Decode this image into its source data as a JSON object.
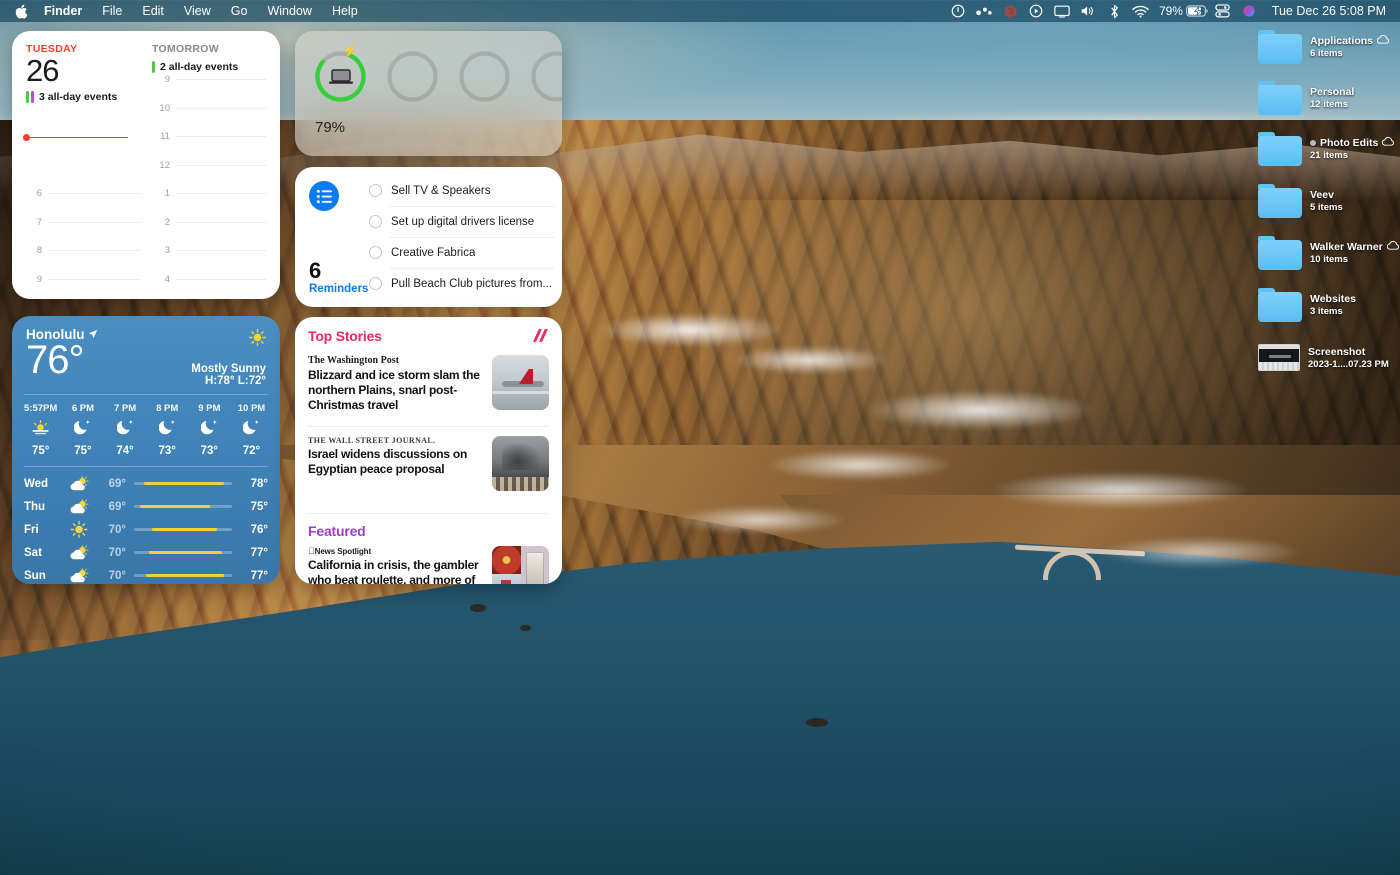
{
  "menubar": {
    "apple_icon": "apple-logo-icon",
    "items": [
      {
        "label": "Finder",
        "bold": true
      },
      {
        "label": "File",
        "bold": false
      },
      {
        "label": "Edit",
        "bold": false
      },
      {
        "label": "View",
        "bold": false
      },
      {
        "label": "Go",
        "bold": false
      },
      {
        "label": "Window",
        "bold": false
      },
      {
        "label": "Help",
        "bold": false
      }
    ],
    "status_icons": [
      "do-not-disturb-icon",
      "bartender-dots-icon",
      "record-red-icon",
      "play-circle-icon",
      "screen-mirroring-icon",
      "volume-icon",
      "bluetooth-icon",
      "wifi-icon"
    ],
    "battery_percent": "79%",
    "battery_icon": "battery-charging-icon",
    "after_battery_icons": [
      "control-center-icon",
      "siri-icon"
    ],
    "clock": "Tue Dec 26  5:08 PM"
  },
  "calendar": {
    "today_label": "TUESDAY",
    "today_date": "26",
    "today_events": "3 all-day events",
    "today_event_colors": [
      "#58c44a",
      "#b24fe0"
    ],
    "tomorrow_label": "TOMORROW",
    "tomorrow_events": "2 all-day events",
    "tomorrow_event_colors": [
      "#58c44a"
    ],
    "left_hours": [
      "6",
      "7",
      "8",
      "9"
    ],
    "right_hours": [
      "9",
      "10",
      "11",
      "12",
      "1",
      "2",
      "3",
      "4"
    ],
    "now_line_color": "#ff3b30"
  },
  "battery_widget": {
    "percent_label": "79%",
    "charge_level": 79,
    "ring_color": "#34d03a",
    "charging_icon": "lightning-bolt-icon",
    "device_icon": "laptop-icon",
    "empty_slots": 3
  },
  "reminders": {
    "app_icon": "reminders-list-icon",
    "count": "6",
    "label": "Reminders",
    "items": [
      "Sell TV & Speakers",
      "Set up digital drivers license",
      "Creative Fabrica",
      "Pull Beach Club pictures from..."
    ]
  },
  "weather": {
    "city": "Honolulu",
    "location_icon": "location-arrow-icon",
    "current_temp": "76°",
    "condition": "Mostly Sunny",
    "high_low": "H:78° L:72°",
    "current_icon": "sun-icon",
    "hourly": [
      {
        "time": "5:57PM",
        "icon": "sunset-icon",
        "temp": "75°"
      },
      {
        "time": "6 PM",
        "icon": "moon-stars-icon",
        "temp": "75°"
      },
      {
        "time": "7 PM",
        "icon": "moon-stars-icon",
        "temp": "74°"
      },
      {
        "time": "8 PM",
        "icon": "moon-stars-icon",
        "temp": "73°"
      },
      {
        "time": "9 PM",
        "icon": "moon-stars-icon",
        "temp": "73°"
      },
      {
        "time": "10 PM",
        "icon": "moon-stars-icon",
        "temp": "72°"
      }
    ],
    "daily": [
      {
        "day": "Wed",
        "icon": "sun-cloud-icon",
        "lo": "69°",
        "hi": "78°",
        "bar_start": 10,
        "bar_end": 92
      },
      {
        "day": "Thu",
        "icon": "sun-cloud-icon",
        "lo": "69°",
        "hi": "75°",
        "bar_start": 6,
        "bar_end": 78
      },
      {
        "day": "Fri",
        "icon": "sun-icon",
        "lo": "70°",
        "hi": "76°",
        "bar_start": 18,
        "bar_end": 85
      },
      {
        "day": "Sat",
        "icon": "sun-cloud-icon",
        "lo": "70°",
        "hi": "77°",
        "bar_start": 15,
        "bar_end": 90
      },
      {
        "day": "Sun",
        "icon": "sun-cloud-icon",
        "lo": "70°",
        "hi": "77°",
        "bar_start": 12,
        "bar_end": 92
      }
    ],
    "accent_bar_color": "#f5ce3e"
  },
  "news": {
    "top_stories_title": "Top Stories",
    "apple_news_icon": "apple-news-icon",
    "stories": [
      {
        "source": "The Washington Post",
        "headline": "Blizzard and ice storm slam the northern Plains, snarl post-Christmas travel",
        "thumbnail": "snowy-airport-plane-photo"
      },
      {
        "source": "THE WALL STREET JOURNAL.",
        "headline": "Israel widens discussions on Egyptian peace proposal",
        "thumbnail": "smoke-over-city-photo"
      }
    ],
    "featured_title": "Featured",
    "featured": {
      "source": "News Spotlight",
      "headline": "California in crisis, the gambler who beat roulette, and more of the year's best stories",
      "thumbnail": "collage-photo"
    },
    "top_stories_color": "#f1285c",
    "featured_color": "#9b3fc4"
  },
  "desktop_icons": [
    {
      "name": "Applications",
      "sub": "6 items",
      "icon": "folder-icon",
      "cloud": true,
      "badge": false
    },
    {
      "name": "Personal",
      "sub": "12 items",
      "icon": "folder-icon",
      "cloud": false,
      "badge": false
    },
    {
      "name": "Photo Edits",
      "sub": "21 items",
      "icon": "folder-icon",
      "cloud": true,
      "badge": true
    },
    {
      "name": "Veev",
      "sub": "5 items",
      "icon": "folder-icon",
      "cloud": false,
      "badge": false
    },
    {
      "name": "Walker Warner",
      "sub": "10 items",
      "icon": "folder-icon",
      "cloud": true,
      "badge": false
    },
    {
      "name": "Websites",
      "sub": "3 items",
      "icon": "folder-icon",
      "cloud": false,
      "badge": false
    },
    {
      "name": "Screenshot",
      "sub": "2023-1....07.23 PM",
      "icon": "screenshot-thumbnail-icon",
      "cloud": false,
      "badge": false
    }
  ]
}
